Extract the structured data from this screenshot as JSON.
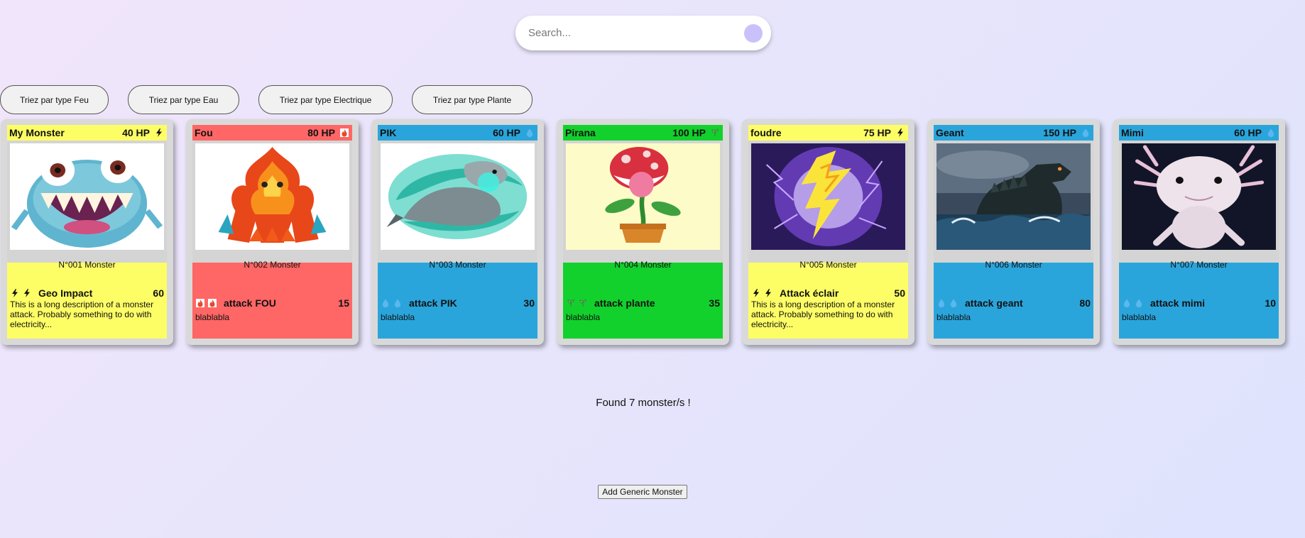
{
  "search": {
    "placeholder": "Search..."
  },
  "filters": [
    {
      "label": "Triez par type Feu"
    },
    {
      "label": "Triez par type Eau"
    },
    {
      "label": "Triez par type Electrique"
    },
    {
      "label": "Triez par type Plante"
    }
  ],
  "cards": [
    {
      "name": "My Monster",
      "hp": "40 HP",
      "type": "electric",
      "color": "#fdfd66",
      "image": "furry blue monster with big teeth",
      "number": "N°001 Monster",
      "attack_name": "Geo Impact",
      "attack_damage": "60",
      "description": "This is a long description of a monster attack. Probably something to do with electricity..."
    },
    {
      "name": "Fou",
      "hp": "80 HP",
      "type": "fire",
      "color": "#ff6666",
      "image": "fire elemental",
      "number": "N°002 Monster",
      "attack_name": "attack FOU",
      "attack_damage": "15",
      "description": "blablabla"
    },
    {
      "name": "PIK",
      "hp": "60 HP",
      "type": "water",
      "color": "#2aa5dc",
      "image": "silver creature in teal swirl",
      "number": "N°003 Monster",
      "attack_name": "attack PIK",
      "attack_damage": "30",
      "description": "blablabla"
    },
    {
      "name": "Pirana",
      "hp": "100 HP",
      "type": "plant",
      "color": "#12d12c",
      "image": "piranha plant in pot",
      "number": "N°004 Monster",
      "attack_name": "attack plante",
      "attack_damage": "35",
      "description": "blablabla"
    },
    {
      "name": "foudre",
      "hp": "75 HP",
      "type": "electric",
      "color": "#fdfd66",
      "image": "lightning creature",
      "number": "N°005 Monster",
      "attack_name": "Attack éclair",
      "attack_damage": "50",
      "description": "This is a long description of a monster attack. Probably something to do with electricity..."
    },
    {
      "name": "Geant",
      "hp": "150 HP",
      "type": "water",
      "color": "#2aa5dc",
      "image": "giant kaiju in stormy sea",
      "number": "N°006 Monster",
      "attack_name": "attack geant",
      "attack_damage": "80",
      "description": "blablabla"
    },
    {
      "name": "Mimi",
      "hp": "60 HP",
      "type": "water",
      "color": "#2aa5dc",
      "image": "axolotl",
      "number": "N°007 Monster",
      "attack_name": "attack mimi",
      "attack_damage": "10",
      "description": "blablabla"
    }
  ],
  "status": {
    "found_text": "Found 7 monster/s !"
  },
  "actions": {
    "add_label": "Add Generic Monster"
  }
}
